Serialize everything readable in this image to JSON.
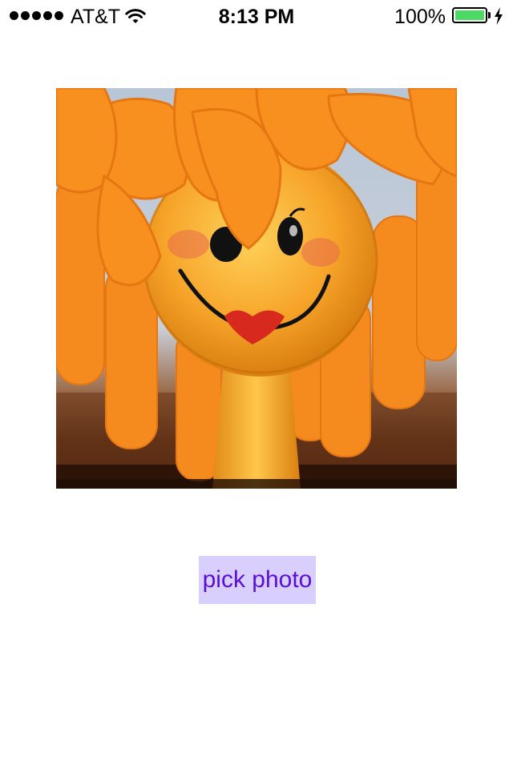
{
  "status_bar": {
    "carrier": "AT&T",
    "time": "8:13 PM",
    "battery_percent": "100%",
    "signal_bars": 5,
    "battery_level": 1.0,
    "battery_color": "#4cd964",
    "icons": [
      "signal-dots-icon",
      "wifi-icon",
      "battery-icon",
      "charging-bolt-icon"
    ]
  },
  "photo": {
    "description_icon": "photo-image"
  },
  "button": {
    "label": "pick photo",
    "background": "#d9cfff",
    "text_color": "#5a0ed9"
  }
}
